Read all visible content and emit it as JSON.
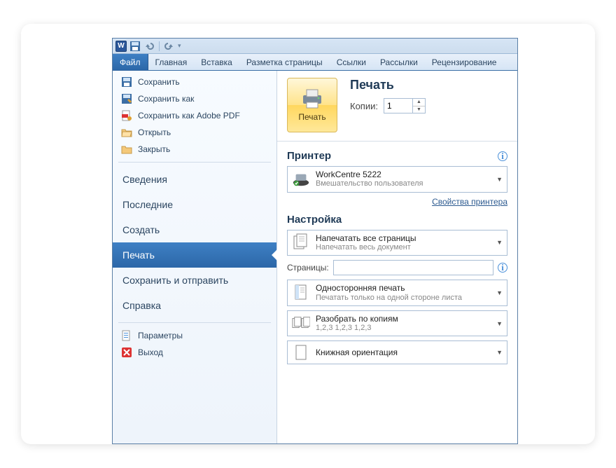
{
  "qat": {
    "app_letter": "W"
  },
  "ribbon": {
    "tabs": [
      "Файл",
      "Главная",
      "Вставка",
      "Разметка страницы",
      "Ссылки",
      "Рассылки",
      "Рецензирование"
    ],
    "active_index": 0
  },
  "sidebar": {
    "icon_items": [
      "Сохранить",
      "Сохранить как",
      "Сохранить как Adobe PDF",
      "Открыть",
      "Закрыть"
    ],
    "text_items": [
      "Сведения",
      "Последние",
      "Создать",
      "Печать",
      "Сохранить и отправить",
      "Справка"
    ],
    "selected_text_index": 3,
    "bottom_items": [
      "Параметры",
      "Выход"
    ]
  },
  "print": {
    "button_label": "Печать",
    "title": "Печать",
    "copies_label": "Копии:",
    "copies_value": "1"
  },
  "printer_section": {
    "title": "Принтер",
    "selected_name": "WorkCentre 5222",
    "selected_status": "Вмешательство пользователя",
    "properties_link": "Свойства принтера"
  },
  "settings_section": {
    "title": "Настройка",
    "print_what": {
      "t1": "Напечатать все страницы",
      "t2": "Напечатать весь документ"
    },
    "pages_label": "Страницы:",
    "pages_value": "",
    "duplex": {
      "t1": "Односторонняя печать",
      "t2": "Печатать только на одной стороне листа"
    },
    "collate": {
      "t1": "Разобрать по копиям",
      "t2": "1,2,3    1,2,3    1,2,3"
    },
    "orientation": {
      "t1": "Книжная ориентация"
    }
  }
}
